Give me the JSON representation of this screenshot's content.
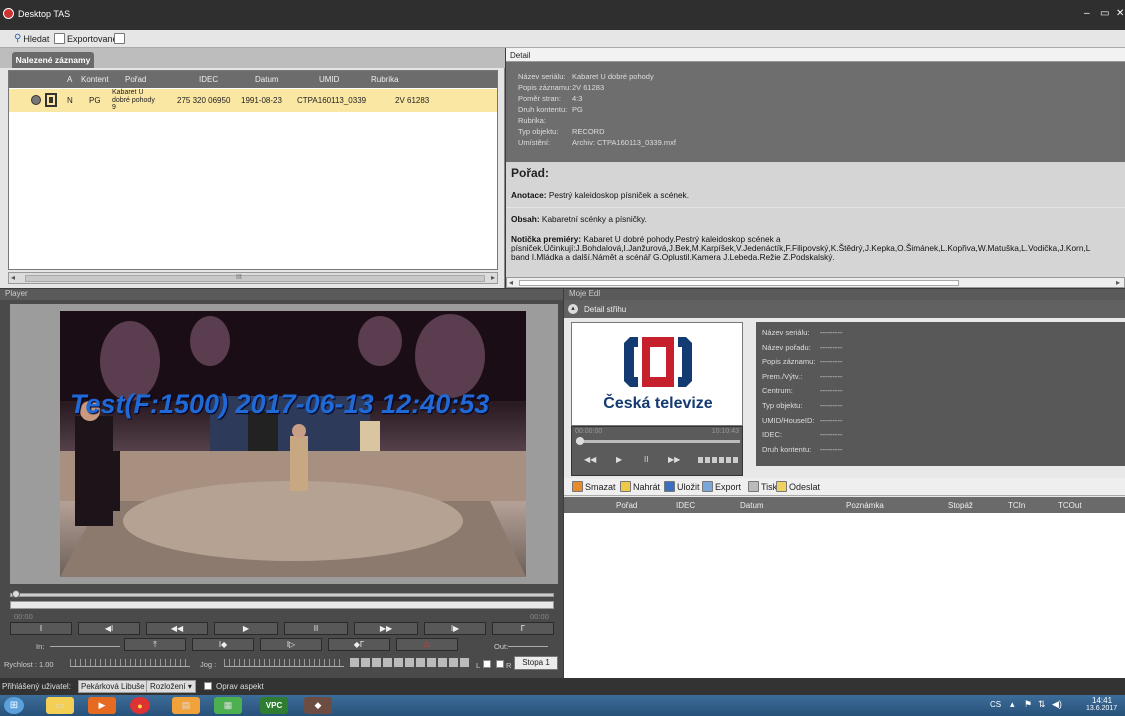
{
  "window": {
    "title": "Desktop TAS",
    "controls": [
      "–",
      "▭",
      "✕"
    ]
  },
  "toolbar": {
    "search_label": "Hledat",
    "exported_label": "Exportované"
  },
  "left_tab": "Nalezené záznamy",
  "grid": {
    "columns": [
      "A",
      "Kontent",
      "Pořad",
      "IDEC",
      "Datum",
      "UMID",
      "Rubrika"
    ],
    "row": {
      "a": "N",
      "kontent": "PG",
      "porad_line1": "Kabaret U",
      "porad_line2": "dobré pohody",
      "porad_line3": "9",
      "idec": "275 320 06950",
      "datum": "1991-08-23",
      "umid": "CTPA160113_0339",
      "rubrika": "2V 61283"
    },
    "scroll_mark": "III"
  },
  "detail": {
    "header": "Detail",
    "meta": [
      {
        "label": "Název seriálu:",
        "value": "Kabaret U dobré pohody"
      },
      {
        "label": "Popis záznamu:",
        "value": "2V 61283"
      },
      {
        "label": "Poměr stran:",
        "value": "4:3"
      },
      {
        "label": "Druh kontentu:",
        "value": "PG"
      },
      {
        "label": "Rubrika:",
        "value": ""
      },
      {
        "label": "Typ objektu:",
        "value": "RECORD"
      },
      {
        "label": "Umístění:",
        "value": "Archiv: CTPA160113_0339.mxf"
      }
    ],
    "porad_heading": "Pořad:",
    "anotace_label": "Anotace:",
    "anotace_text": "Pestrý kaleidoskop písniček a scének.",
    "obsah_label": "Obsah:",
    "obsah_text": "Kabaretní scénky a písničky.",
    "noticka_label": "Notička premiéry:",
    "noticka_line1": "Kabaret U dobré pohody.Pestrý kaleidoskop scének a",
    "noticka_line2": "písniček.Účinkují:J.Bohdalová,I.Janžurová,J.Bek,M.Karpíšek,V.Jedenáctík,F.Filipovský,K.Štědrý,J.Kepka,O.Šimánek,L.Kopřiva,W.Matuška,L.Vodička,J.Korn,L",
    "noticka_line3": "band I.Mládka a další.Námět a scénář G.Oplustil.Kamera J.Lebeda.Režie Z.Podskalský."
  },
  "player": {
    "header": "Player",
    "overlay": "Test(F:1500) 2017-06-13 12:40:53",
    "tc_left": "00:00",
    "tc_right": "00:00",
    "buttons": [
      "I",
      "◀I",
      "◀◀",
      "▶",
      "II",
      "▶▶",
      "I▶",
      "Γ"
    ],
    "row2_buttons": [
      "In:",
      "⤒",
      "I◆",
      "I▷",
      "◆Γ",
      "⚠",
      "Out:"
    ],
    "speed_label": "Rychlost : 1.00",
    "jog_label": "Jog :",
    "lr_label": "L",
    "r_label": "R",
    "track_button": "Stopa 1"
  },
  "edl": {
    "header": "Moje Edl",
    "detail_strihu": "Detail střihu",
    "brand_text": "Česká televize",
    "tc_start": "00:00:00",
    "tc_end": "10:10:43",
    "meta": [
      {
        "label": "Název seriálu:",
        "value": "---------"
      },
      {
        "label": "Název pořadu:",
        "value": "---------"
      },
      {
        "label": "Popis záznamu:",
        "value": "---------"
      },
      {
        "label": "Prem./Výtv.:",
        "value": "---------"
      },
      {
        "label": "Centrum:",
        "value": "---------"
      },
      {
        "label": "Typ objektu:",
        "value": "---------"
      },
      {
        "label": "UMID/HouseID:",
        "value": "---------"
      },
      {
        "label": "IDEC:",
        "value": "---------"
      },
      {
        "label": "Druh kontentu:",
        "value": "---------"
      }
    ],
    "tools": [
      "Smazat",
      "Nahrát",
      "Uložit",
      "Export",
      "Tisk",
      "Odeslat"
    ],
    "columns": [
      "Pořad",
      "IDEC",
      "Datum",
      "Poznámka",
      "Stopáž",
      "TCIn",
      "TCOut"
    ]
  },
  "status": {
    "user_label": "Přihlášený uživatel:",
    "user_value": "Pekárková Libuše",
    "layout_label": "Rozložení",
    "aspect_label": "Oprav aspekt"
  },
  "taskbar": {
    "lang": "CS",
    "time": "14:41",
    "date": "13.6.2017",
    "vpc_label": "VPC"
  }
}
